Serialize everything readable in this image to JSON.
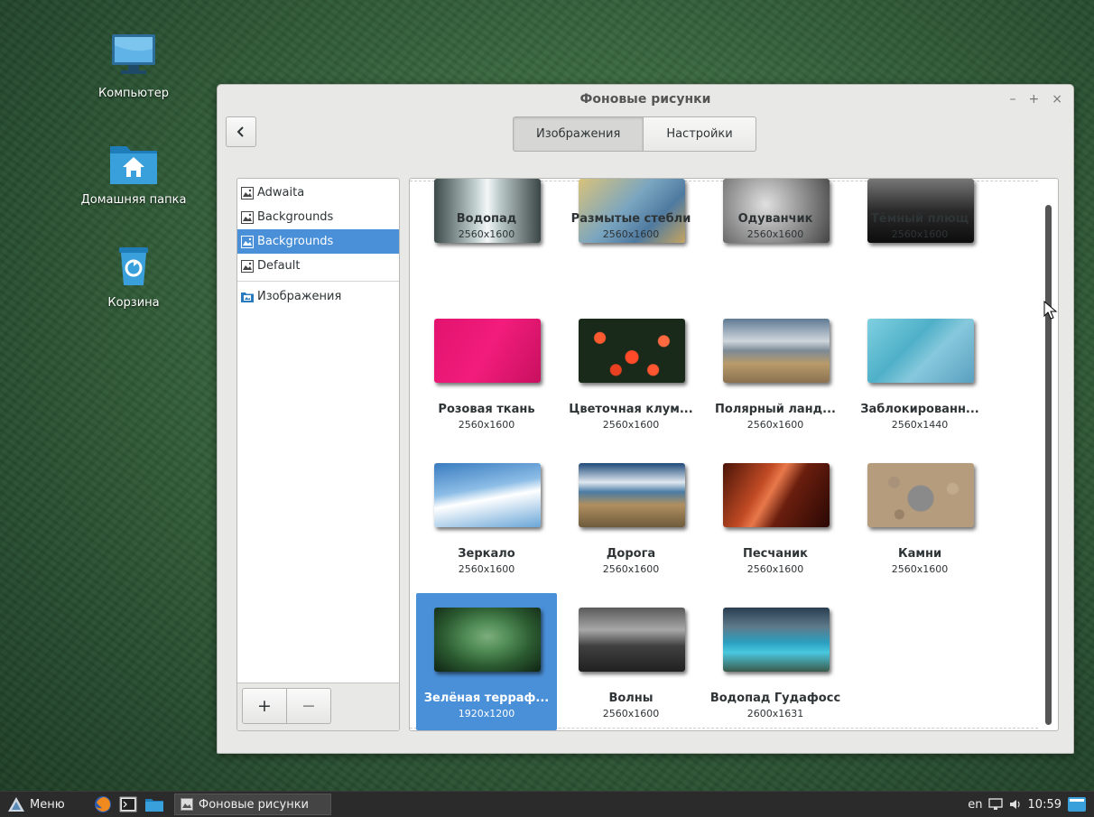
{
  "desktop": {
    "icons": [
      {
        "label": "Компьютер",
        "icon": "computer-icon"
      },
      {
        "label": "Домашняя папка",
        "icon": "home-folder-icon"
      },
      {
        "label": "Корзина",
        "icon": "trash-icon"
      }
    ]
  },
  "window": {
    "title": "Фоновые рисунки",
    "controls": {
      "minimize": "–",
      "maximize": "+",
      "close": "×"
    },
    "back_icon": "chevron-left-icon",
    "tabs": [
      {
        "label": "Изображения",
        "active": true
      },
      {
        "label": "Настройки",
        "active": false
      }
    ]
  },
  "sidebar": {
    "items": [
      {
        "label": "Adwaita",
        "icon": "image-icon",
        "selected": false
      },
      {
        "label": "Backgrounds",
        "icon": "image-icon",
        "selected": false
      },
      {
        "label": "Backgrounds",
        "icon": "image-icon",
        "selected": true
      },
      {
        "label": "Default",
        "icon": "image-icon",
        "selected": false
      },
      {
        "label": "Изображения",
        "icon": "pictures-folder-icon",
        "selected": false
      }
    ],
    "add_label": "+",
    "remove_label": "−"
  },
  "wallpapers": [
    {
      "name": "Водопад",
      "res": "2560x1600",
      "thumb": "waterfall"
    },
    {
      "name": "Размытые стебли",
      "res": "2560x1600",
      "thumb": "stems"
    },
    {
      "name": "Одуванчик",
      "res": "2560x1600",
      "thumb": "dandelion"
    },
    {
      "name": "Тёмный плющ",
      "res": "2560x1600",
      "thumb": "ivy"
    },
    {
      "name": "Розовая ткань",
      "res": "2560x1600",
      "thumb": "pink"
    },
    {
      "name": "Цветочная клум...",
      "res": "2560x1600",
      "thumb": "flowers"
    },
    {
      "name": "Полярный ланд...",
      "res": "2560x1600",
      "thumb": "polar"
    },
    {
      "name": "Заблокированн...",
      "res": "2560x1440",
      "thumb": "blocked"
    },
    {
      "name": "Зеркало",
      "res": "2560x1600",
      "thumb": "mirror"
    },
    {
      "name": "Дорога",
      "res": "2560x1600",
      "thumb": "road"
    },
    {
      "name": "Песчаник",
      "res": "2560x1600",
      "thumb": "sandstone"
    },
    {
      "name": "Камни",
      "res": "2560x1600",
      "thumb": "stones"
    },
    {
      "name": "Зелёная терраф...",
      "res": "1920x1200",
      "thumb": "green",
      "selected": true
    },
    {
      "name": "Волны",
      "res": "2560x1600",
      "thumb": "waves"
    },
    {
      "name": "Водопад Гудафосс",
      "res": "2600x1631",
      "thumb": "godafoss"
    }
  ],
  "taskbar": {
    "menu_label": "Меню",
    "launchers": [
      "firefox-icon",
      "terminal-icon",
      "files-icon"
    ],
    "active_app": "Фоновые рисунки",
    "keyboard": "en",
    "clock": "10:59"
  },
  "colors": {
    "selection": "#4a90d9",
    "taskbar": "#2b2b2b",
    "desktop": "#2f5a36"
  }
}
